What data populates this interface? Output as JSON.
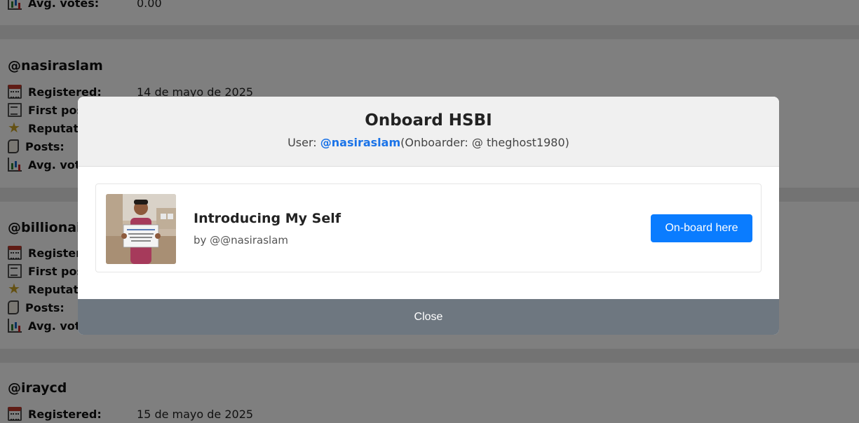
{
  "colors": {
    "accent": "#0a7cff",
    "close_bar": "#6e7780",
    "link": "#1a73e8",
    "overlay": "rgba(0,0,0,0.5)"
  },
  "background": {
    "cards": [
      {
        "handle": "",
        "stats": [
          {
            "icon": "chart-icon",
            "label": "Avg. votes:",
            "value": "0.00"
          }
        ]
      },
      {
        "handle": "@nasiraslam",
        "stats": [
          {
            "icon": "calendar-icon",
            "label": "Registered:",
            "value": "14 de mayo de 2025"
          },
          {
            "icon": "memo-icon",
            "label": "First post:",
            "value": ""
          },
          {
            "icon": "star-icon",
            "label": "Reputation:",
            "value": ""
          },
          {
            "icon": "scroll-icon",
            "label": "Posts:",
            "value": ""
          },
          {
            "icon": "chart-icon",
            "label": "Avg. votes:",
            "value": ""
          }
        ]
      },
      {
        "handle": "@billionaire",
        "stats": [
          {
            "icon": "calendar-icon",
            "label": "Registered:",
            "value": ""
          },
          {
            "icon": "memo-icon",
            "label": "First post:",
            "value": ""
          },
          {
            "icon": "star-icon",
            "label": "Reputation:",
            "value": ""
          },
          {
            "icon": "scroll-icon",
            "label": "Posts:",
            "value": ""
          },
          {
            "icon": "chart-icon",
            "label": "Avg. votes:",
            "value": ""
          }
        ]
      },
      {
        "handle": "@iraycd",
        "stats": [
          {
            "icon": "calendar-icon",
            "label": "Registered:",
            "value": "15 de mayo de 2025"
          }
        ]
      }
    ]
  },
  "modal": {
    "title": "Onboard HSBI",
    "user_prefix": "User: ",
    "user_handle": "@nasiraslam",
    "onboarder_text": "(Onboarder: @ theghost1980)",
    "post": {
      "title": "Introducing My Self",
      "author": "by @@nasiraslam",
      "thumbnail_alt": "post thumbnail"
    },
    "onboard_button": "On-board here",
    "close_label": "Close"
  }
}
